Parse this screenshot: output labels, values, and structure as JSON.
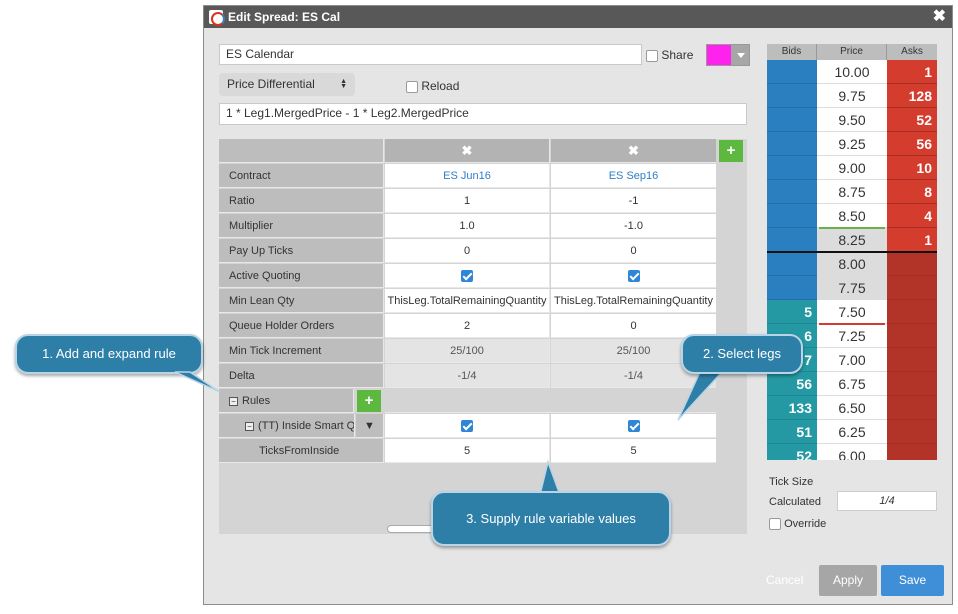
{
  "dialog": {
    "title": "Edit Spread: ES Cal",
    "spread_name": "ES Calendar",
    "share_label": "Share",
    "share_checked": false,
    "color": "#ff22ee",
    "price_type": "Price Differential",
    "reload_label": "Reload",
    "formula": "1 * Leg1.MergedPrice - 1 * Leg2.MergedPrice"
  },
  "legs_table": {
    "rows": [
      {
        "label": "Contract",
        "leg1": "ES Jun16",
        "leg2": "ES Sep16"
      },
      {
        "label": "Ratio",
        "leg1": "1",
        "leg2": "-1"
      },
      {
        "label": "Multiplier",
        "leg1": "1.0",
        "leg2": "-1.0"
      },
      {
        "label": "Pay Up Ticks",
        "leg1": "0",
        "leg2": "0"
      },
      {
        "label": "Active Quoting",
        "leg1": "",
        "leg2": ""
      },
      {
        "label": "Min Lean Qty",
        "leg1": "ThisLeg.TotalRemainingQuantity",
        "leg2": "ThisLeg.TotalRemainingQuantity"
      },
      {
        "label": "Queue Holder Orders",
        "leg1": "2",
        "leg2": "0"
      },
      {
        "label": "Min Tick Increment",
        "leg1": "25/100",
        "leg2": "25/100"
      },
      {
        "label": "Delta",
        "leg1": "-1/4",
        "leg2": "-1/4"
      }
    ],
    "rules_label": "Rules",
    "rule_name": "(TT) Inside Smart Q",
    "rule_variable": {
      "label": "TicksFromInside",
      "leg1": "5",
      "leg2": "5"
    }
  },
  "ladder": {
    "headers": [
      "Bids",
      "Price",
      "Asks"
    ],
    "rows": [
      {
        "bid": "",
        "price": "10.00",
        "ask": "1"
      },
      {
        "bid": "",
        "price": "9.75",
        "ask": "128"
      },
      {
        "bid": "",
        "price": "9.50",
        "ask": "52"
      },
      {
        "bid": "",
        "price": "9.25",
        "ask": "56"
      },
      {
        "bid": "",
        "price": "9.00",
        "ask": "10"
      },
      {
        "bid": "",
        "price": "8.75",
        "ask": "8"
      },
      {
        "bid": "",
        "price": "8.50",
        "ask": "4"
      },
      {
        "bid": "",
        "price": "8.25",
        "ask": "1"
      },
      {
        "bid": "",
        "price": "8.00",
        "ask": ""
      },
      {
        "bid": "",
        "price": "7.75",
        "ask": ""
      },
      {
        "bid": "5",
        "price": "7.50",
        "ask": ""
      },
      {
        "bid": "6",
        "price": "7.25",
        "ask": ""
      },
      {
        "bid": "7",
        "price": "7.00",
        "ask": ""
      },
      {
        "bid": "56",
        "price": "6.75",
        "ask": ""
      },
      {
        "bid": "133",
        "price": "6.50",
        "ask": ""
      },
      {
        "bid": "51",
        "price": "6.25",
        "ask": ""
      },
      {
        "bid": "52",
        "price": "6.00",
        "ask": ""
      }
    ],
    "colors": {
      "bid_blue": "#2a7fc0",
      "bid_teal": "#2499a3",
      "ask_red": "#d43c2e",
      "ask_dark": "#b23328"
    }
  },
  "tick_size": {
    "label": "Tick Size",
    "calculated_label": "Calculated",
    "calculated_value": "1/4",
    "override_label": "Override"
  },
  "buttons": {
    "cancel": "Cancel",
    "apply": "Apply",
    "save": "Save"
  },
  "callouts": {
    "c1": "1. Add  and expand rule",
    "c2": "2. Select legs",
    "c3": "3. Supply rule variable values"
  },
  "icons": {
    "close": "close-icon",
    "add": "plus-icon",
    "remove": "x-icon",
    "collapse": "minus-box-icon"
  }
}
